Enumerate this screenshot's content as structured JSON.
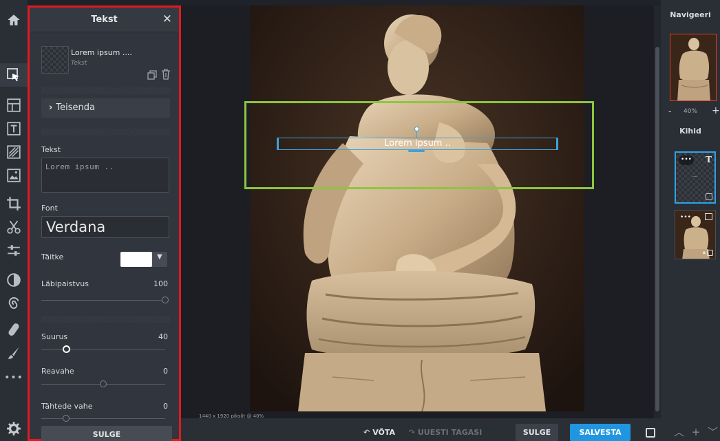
{
  "panel": {
    "title": "Tekst",
    "close_glyph": "✕",
    "layer_name": "Lorem ipsum ....",
    "layer_type": "Tekst",
    "transform_label": "Teisenda",
    "text_label": "Tekst",
    "text_value": "Lorem ipsum ..",
    "font_label": "Font",
    "font_value": "Verdana",
    "fill_label": "Täitke",
    "fill_color": "#ffffff",
    "opacity_label": "Läbipaistvus",
    "opacity_value": "100",
    "opacity_level": 1.0,
    "size_label": "Suurus",
    "size_value": "40",
    "size_level": 0.2,
    "line_spacing_label": "Reavahe",
    "line_spacing_value": "0",
    "line_spacing_level": 0.5,
    "letter_spacing_label": "Tähtede vahe",
    "letter_spacing_value": "0",
    "letter_spacing_level": 0.2,
    "close_button": "SULGE"
  },
  "canvas": {
    "overlay_text": "Lorem ipsum ..",
    "size_info": "1440 x 1920 pikslit @ 40%"
  },
  "navigator": {
    "title": "Navigeeri",
    "zoom_minus": "-",
    "zoom": "40%",
    "zoom_plus": "+"
  },
  "layers": {
    "title": "Kihid",
    "dots": "•••"
  },
  "bottom": {
    "undo": "VÕTA",
    "redo": "UUESTI TAGASI",
    "close": "SULGE",
    "save": "SALVESTA"
  },
  "colors": {
    "accent_blue": "#2196e0",
    "selection_green": "#8cc63f",
    "highlight_red": "#e11a20"
  },
  "tools": [
    "home-icon",
    "select-icon",
    "layout-icon",
    "text-icon",
    "texture-icon",
    "image-icon",
    "crop-icon",
    "cut-icon",
    "adjust-icon",
    "contrast-icon",
    "spiral-icon",
    "bandage-icon",
    "brush-icon",
    "more-icon",
    "settings-icon"
  ]
}
